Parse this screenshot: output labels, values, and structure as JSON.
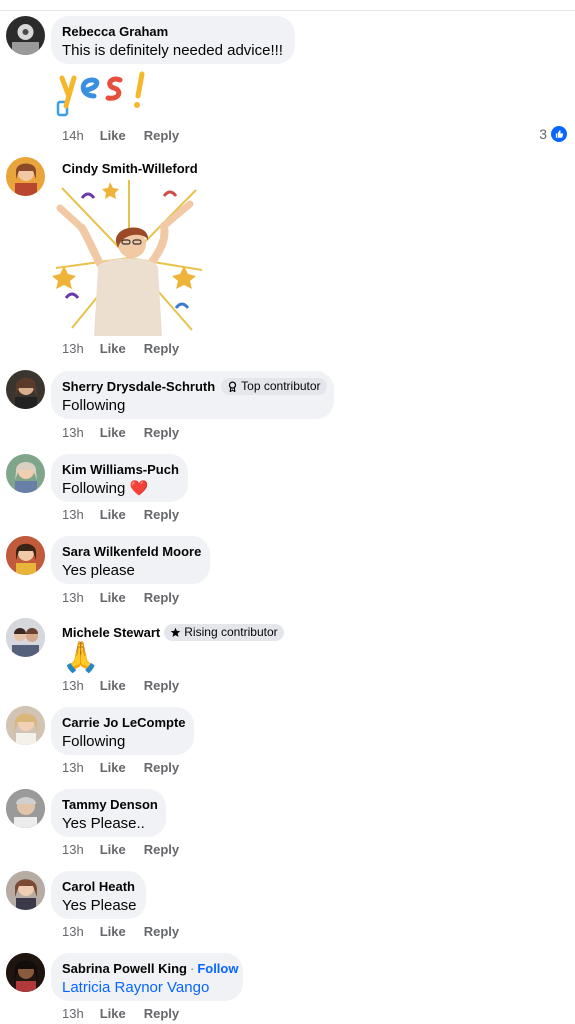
{
  "comments": [
    {
      "author": "Rebecca Graham",
      "text": "This is definitely needed advice!!!",
      "sticker": "yes!",
      "time": "14h",
      "like": "Like",
      "reply": "Reply",
      "reaction_count": "3"
    },
    {
      "author": "Cindy Smith-Willeford",
      "sticker": "celebration",
      "time": "13h",
      "like": "Like",
      "reply": "Reply"
    },
    {
      "author": "Sherry Drysdale-Schruth",
      "badge": "Top contributor",
      "text": "Following",
      "time": "13h",
      "like": "Like",
      "reply": "Reply"
    },
    {
      "author": "Kim Williams-Puch",
      "text": "Following",
      "emoji": "❤️",
      "time": "13h",
      "like": "Like",
      "reply": "Reply"
    },
    {
      "author": "Sara Wilkenfeld Moore",
      "text": "Yes please",
      "time": "13h",
      "like": "Like",
      "reply": "Reply"
    },
    {
      "author": "Michele Stewart",
      "badge": "Rising contributor",
      "emoji": "🙏",
      "time": "13h",
      "like": "Like",
      "reply": "Reply"
    },
    {
      "author": "Carrie Jo LeCompte",
      "text": "Following",
      "time": "13h",
      "like": "Like",
      "reply": "Reply"
    },
    {
      "author": "Tammy Denson",
      "text": "Yes Please..",
      "time": "13h",
      "like": "Like",
      "reply": "Reply"
    },
    {
      "author": "Carol Heath",
      "text": "Yes Please",
      "time": "13h",
      "like": "Like",
      "reply": "Reply"
    },
    {
      "author": "Sabrina Powell King",
      "separator": "·",
      "follow": "Follow",
      "text": "Latricia Raynor Vango",
      "time": "13h",
      "like": "Like",
      "reply": "Reply"
    }
  ],
  "colors": {
    "accent": "#0866ff",
    "bubble": "#f0f2f5",
    "meta": "#65676b",
    "heart": "#e0245e"
  },
  "icons": {
    "reaction": "like-thumb-icon",
    "top_contributor": "award-icon",
    "rising_contributor": "star-icon"
  }
}
